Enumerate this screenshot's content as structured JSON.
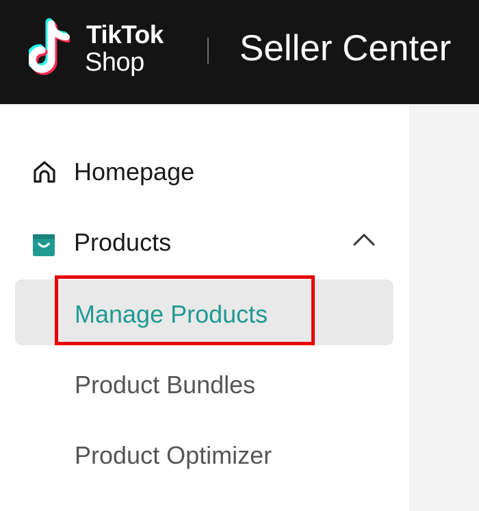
{
  "header": {
    "brand_line1": "TikTok",
    "brand_line2": "Shop",
    "title": "Seller Center"
  },
  "sidebar": {
    "homepage": {
      "label": "Homepage",
      "icon": "home-icon"
    },
    "products": {
      "label": "Products",
      "icon": "shopping-bag-icon",
      "expanded": true,
      "children": [
        {
          "label": "Manage Products",
          "active": true
        },
        {
          "label": "Product Bundles",
          "active": false
        },
        {
          "label": "Product Optimizer",
          "active": false
        }
      ]
    }
  },
  "colors": {
    "header_bg": "#141414",
    "accent": "#1f9a92",
    "highlight_border": "#e60000",
    "content_bg": "#f3f3f3"
  }
}
